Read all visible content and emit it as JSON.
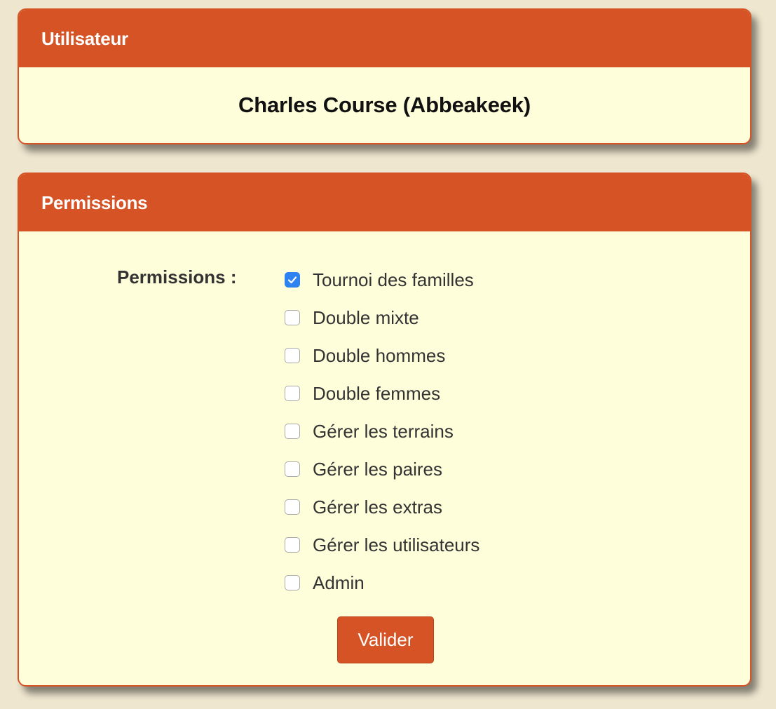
{
  "user_panel": {
    "title": "Utilisateur",
    "name": "Charles Course (Abbeakeek)"
  },
  "permissions_panel": {
    "title": "Permissions",
    "field_label": "Permissions :",
    "options": [
      {
        "label": "Tournoi des familles",
        "checked": true
      },
      {
        "label": "Double mixte",
        "checked": false
      },
      {
        "label": "Double hommes",
        "checked": false
      },
      {
        "label": "Double femmes",
        "checked": false
      },
      {
        "label": "Gérer les terrains",
        "checked": false
      },
      {
        "label": "Gérer les paires",
        "checked": false
      },
      {
        "label": "Gérer les extras",
        "checked": false
      },
      {
        "label": "Gérer les utilisateurs",
        "checked": false
      },
      {
        "label": "Admin",
        "checked": false
      }
    ],
    "submit_label": "Valider"
  },
  "colors": {
    "accent": "#d55325",
    "panel_bg": "#fffedb",
    "page_bg": "#efe6cf",
    "checkbox_checked": "#2f83f0"
  }
}
